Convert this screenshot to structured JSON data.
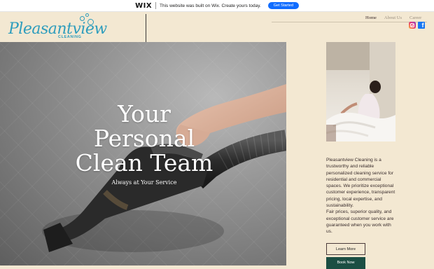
{
  "wix_banner": {
    "logo": "WIX",
    "message": "This website was built on Wix. Create yours today.",
    "cta_label": "Get Started"
  },
  "brand": {
    "logo_text": "Pleasantview",
    "logo_subtext": "CLEANING",
    "accent_color": "#2e9dbd"
  },
  "nav": {
    "items": [
      {
        "label": "Home",
        "active": true
      },
      {
        "label": "About Us",
        "active": false
      },
      {
        "label": "Career",
        "active": false
      }
    ]
  },
  "social": {
    "icons": [
      "instagram-icon",
      "facebook-icon"
    ],
    "facebook_glyph": "f"
  },
  "hero": {
    "title_lines": [
      "Your",
      "Personal",
      "Clean Team"
    ],
    "subtitle": "Always at Your Service"
  },
  "about": {
    "paragraph": "Pleasantview Cleaning is a trustworthy and reliable personalized cleaning service for residential and commercial spaces. We prioritize exceptional customer experience, transparent pricing, local expertise, and sustainability.",
    "paragraph2": "Fair prices, superior quality, and exceptional customer service are guaranteed when you work with us."
  },
  "buttons": {
    "learn_more": "Learn More",
    "book_now": "Book Now"
  },
  "colors": {
    "page_bg": "#f3e8d2",
    "book_button_bg": "#1b4e43",
    "wix_button_bg": "#116dff"
  }
}
